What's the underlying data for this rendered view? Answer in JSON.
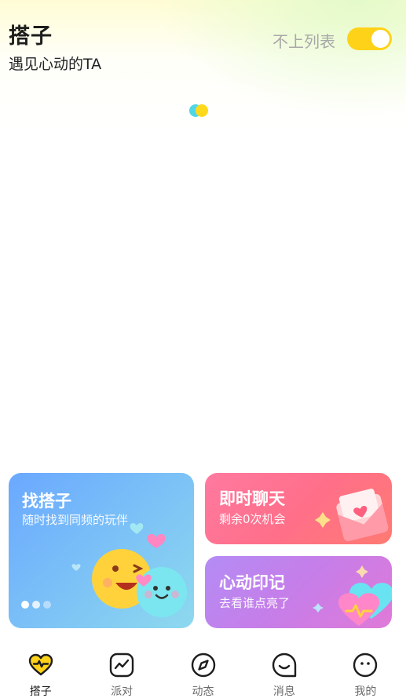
{
  "header": {
    "title": "搭子",
    "subtitle": "遇见心动的TA",
    "toggle_label": "不上列表",
    "toggle_on": true
  },
  "cards": {
    "find": {
      "title": "找搭子",
      "subtitle": "随时找到同频的玩伴"
    },
    "chat": {
      "title": "即时聊天",
      "subtitle": "剩余0次机会"
    },
    "heart": {
      "title": "心动印记",
      "subtitle": "去看谁点亮了"
    }
  },
  "tabs": [
    {
      "label": "搭子",
      "icon": "heart-pulse-icon",
      "active": true
    },
    {
      "label": "派对",
      "icon": "trend-chat-icon",
      "active": false
    },
    {
      "label": "动态",
      "icon": "compass-icon",
      "active": false
    },
    {
      "label": "消息",
      "icon": "smile-bubble-icon",
      "active": false
    },
    {
      "label": "我的",
      "icon": "face-icon",
      "active": false
    }
  ],
  "colors": {
    "accent": "#ffd21a",
    "find_card": "#6aa8ff",
    "chat_card": "#ff6f8a",
    "heart_card": "#c77de8"
  }
}
